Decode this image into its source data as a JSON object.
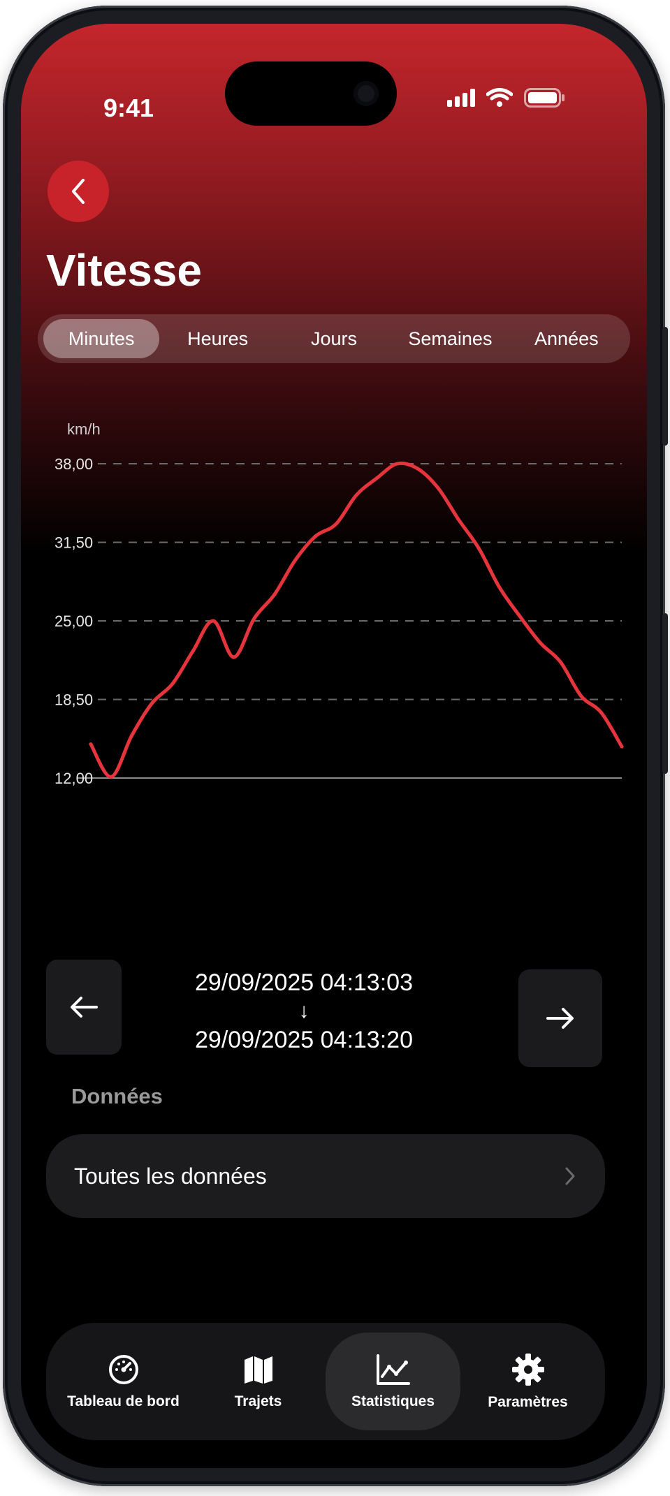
{
  "status_bar": {
    "time": "9:41"
  },
  "header": {
    "title": "Vitesse"
  },
  "period_tabs": [
    {
      "label": "Minutes",
      "active": true
    },
    {
      "label": "Heures",
      "active": false
    },
    {
      "label": "Jours",
      "active": false
    },
    {
      "label": "Semaines",
      "active": false
    },
    {
      "label": "Années",
      "active": false
    }
  ],
  "chart_data": {
    "type": "line",
    "ylabel": "km/h",
    "ylim": [
      12,
      38
    ],
    "yticks": [
      "38,00",
      "31,50",
      "25,00",
      "18,50",
      "12,00"
    ],
    "grid": true,
    "series": [
      {
        "color": "#e5343c",
        "values": [
          14.8,
          12.1,
          15.5,
          18.2,
          19.8,
          22.5,
          25.0,
          22.0,
          25.2,
          27.2,
          30.0,
          32.0,
          33.0,
          35.4,
          36.8,
          38.0,
          37.6,
          36.0,
          33.4,
          31.0,
          27.8,
          25.4,
          23.2,
          21.6,
          18.8,
          17.4,
          14.6
        ]
      }
    ]
  },
  "range": {
    "start": "29/09/2025 04:13:03",
    "arrow": "↓",
    "end": "29/09/2025 04:13:20"
  },
  "data_section": {
    "label": "Données",
    "row_label": "Toutes les données"
  },
  "tab_bar": [
    {
      "label": "Tableau de bord",
      "icon": "speedometer-icon",
      "active": false
    },
    {
      "label": "Trajets",
      "icon": "map-icon",
      "active": false
    },
    {
      "label": "Statistiques",
      "icon": "chart-icon",
      "active": true
    },
    {
      "label": "Paramètres",
      "icon": "gear-icon",
      "active": false
    }
  ],
  "colors": {
    "accent": "#c8232a",
    "line": "#e5343c",
    "background": "#000000"
  }
}
